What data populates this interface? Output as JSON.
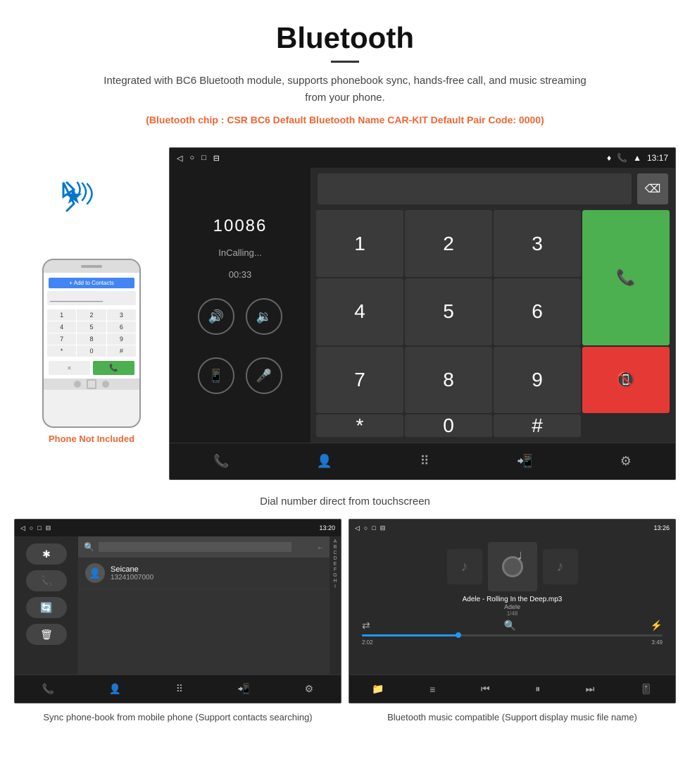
{
  "header": {
    "title": "Bluetooth",
    "description": "Integrated with BC6 Bluetooth module, supports phonebook sync, hands-free call, and music streaming from your phone.",
    "specs": "(Bluetooth chip : CSR BC6    Default Bluetooth Name CAR-KIT    Default Pair Code: 0000)"
  },
  "phone_side": {
    "not_included": "Phone Not Included"
  },
  "dial_screen": {
    "status_time": "13:17",
    "number": "10086",
    "status": "InCalling...",
    "timer": "00:33",
    "keys": [
      "1",
      "2",
      "3",
      "*",
      "4",
      "5",
      "6",
      "0",
      "7",
      "8",
      "9",
      "#"
    ]
  },
  "captions": {
    "dial": "Dial number direct from touchscreen",
    "phonebook": "Sync phone-book from mobile phone\n(Support contacts searching)",
    "music": "Bluetooth music compatible\n(Support display music file name)"
  },
  "phonebook_screen": {
    "status_time": "13:20",
    "contact_name": "Seicane",
    "contact_phone": "13241007000",
    "alpha_list": [
      "A",
      "B",
      "C",
      "D",
      "E",
      "F",
      "G",
      "H",
      "I"
    ]
  },
  "music_screen": {
    "status_time": "13:26",
    "track_name": "Adele - Rolling In the Deep.mp3",
    "artist": "Adele",
    "track_count": "1/48",
    "time_current": "2:02",
    "time_total": "3:49",
    "progress": 32
  }
}
